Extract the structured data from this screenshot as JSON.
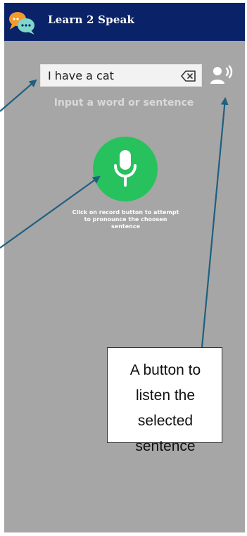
{
  "header": {
    "title": "Learn 2 Speak",
    "logo_icon": "speech-bubbles-icon",
    "background": "#0a2268"
  },
  "search": {
    "value": "I have a cat",
    "placeholder": "Input a word or sentence",
    "clear_icon": "backspace-clear-icon"
  },
  "speaker": {
    "icon": "speaking-person-icon"
  },
  "hint": "Input a word or sentence",
  "record": {
    "icon": "microphone-icon",
    "color": "#27c25e",
    "instruction": "Click on record button to attempt to pronounce the choosen sentence"
  },
  "annotation": {
    "text": "A button to listen the selected sentence",
    "arrow_color": "#1f5f80"
  },
  "app_background": "#a6a6a6"
}
